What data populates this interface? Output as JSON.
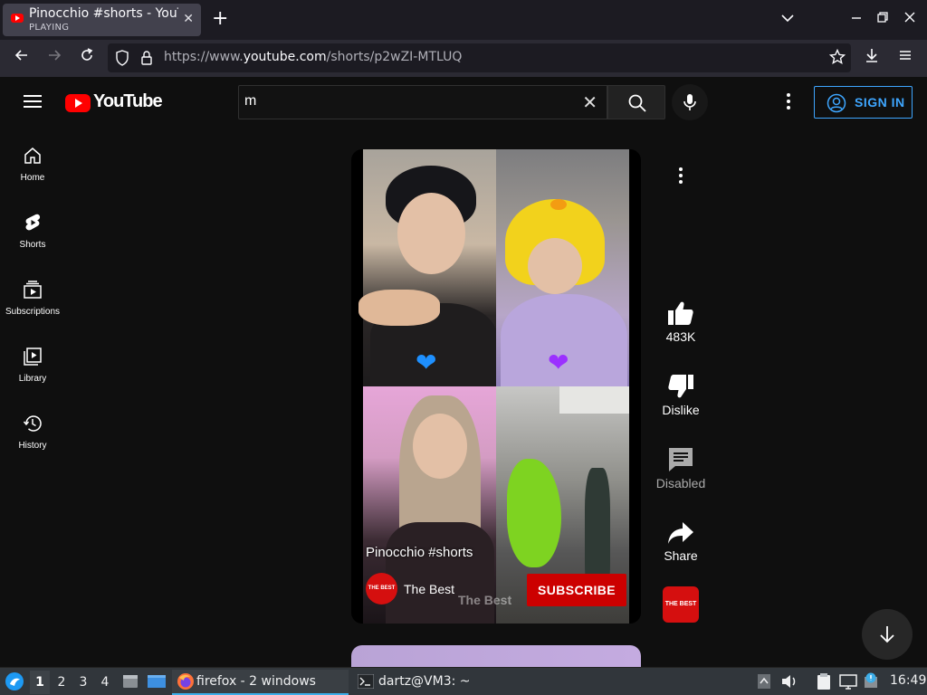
{
  "browser": {
    "tab_title": "Pinocchio #shorts - YouTube",
    "tab_status": "PLAYING",
    "url_prefix": "https://www.",
    "url_domain": "youtube.com",
    "url_path": "/shorts/p2wZI-MTLUQ"
  },
  "youtube": {
    "logo_text": "YouTube",
    "search_value": "m",
    "sign_in": "SIGN IN",
    "sidebar": [
      {
        "label": "Home",
        "icon": "home-icon"
      },
      {
        "label": "Shorts",
        "icon": "shorts-icon"
      },
      {
        "label": "Subscriptions",
        "icon": "subscriptions-icon"
      },
      {
        "label": "Library",
        "icon": "library-icon"
      },
      {
        "label": "History",
        "icon": "history-icon"
      }
    ],
    "short": {
      "title": "Pinocchio #shorts",
      "channel": "The Best",
      "channel_avatar_text": "THE BEST",
      "watermark": "The Best",
      "subscribe": "SUBSCRIBE"
    },
    "actions": {
      "like_count": "483K",
      "dislike": "Dislike",
      "comments": "Disabled",
      "share": "Share",
      "channel_logo_text": "THE BEST"
    }
  },
  "taskbar": {
    "workspaces": [
      "1",
      "2",
      "3",
      "4"
    ],
    "active_workspace": "1",
    "firefox": "firefox - 2 windows",
    "terminal": "dartz@VM3: ~",
    "clock": "16:49"
  },
  "colors": {
    "yt_red": "#ff0000",
    "signin_blue": "#3ea6ff",
    "subscribe_red": "#cc0000",
    "taskbar_bg": "#31363b"
  }
}
